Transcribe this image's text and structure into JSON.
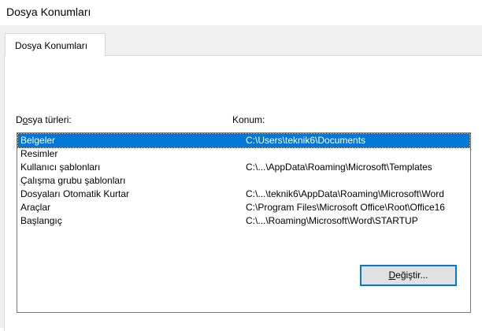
{
  "window": {
    "title": "Dosya Konumları"
  },
  "tabs": [
    {
      "label": "Dosya Konumları",
      "active": true
    }
  ],
  "columns": {
    "file_types": {
      "mnemonic": "o",
      "prefix": "D",
      "suffix": "sya türleri:",
      "full": "Dosya türleri:"
    },
    "location": "Konum:"
  },
  "file_locations": [
    {
      "type": "Belgeler",
      "location": "C:\\Users\\teknik6\\Documents",
      "selected": true
    },
    {
      "type": "Resimler",
      "location": "",
      "selected": false
    },
    {
      "type": "Kullanıcı şablonları",
      "location": "C:\\...\\AppData\\Roaming\\Microsoft\\Templates",
      "selected": false
    },
    {
      "type": "Çalışma grubu şablonları",
      "location": "",
      "selected": false
    },
    {
      "type": "Dosyaları Otomatik Kurtar",
      "location": "C:\\...\\teknik6\\AppData\\Roaming\\Microsoft\\Word",
      "selected": false
    },
    {
      "type": "Araçlar",
      "location": "C:\\Program Files\\Microsoft Office\\Root\\Office16",
      "selected": false
    },
    {
      "type": "Başlangıç",
      "location": "C:\\...\\Roaming\\Microsoft\\Word\\STARTUP",
      "selected": false
    }
  ],
  "buttons": {
    "modify": {
      "mnemonic": "D",
      "suffix": "eğiştir...",
      "full": "Değiştir..."
    }
  },
  "colors": {
    "selection": "#0078d7",
    "button_focus_border": "#0078d7"
  }
}
